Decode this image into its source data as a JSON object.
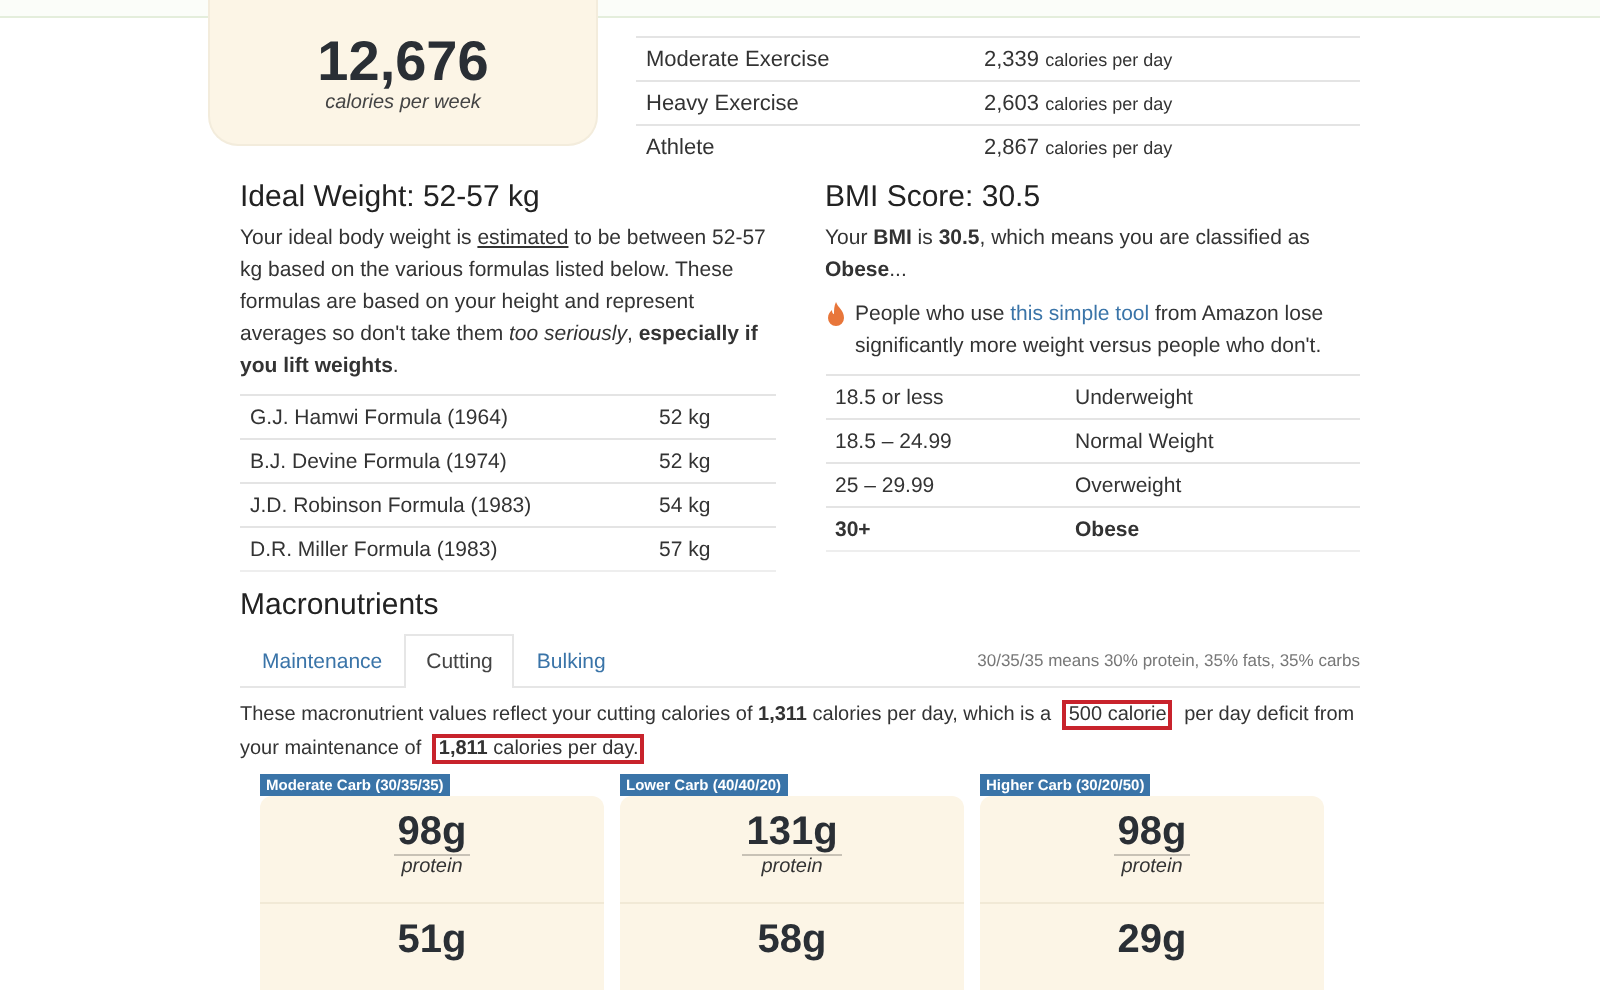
{
  "summary": {
    "value": "12,676",
    "unit": "calories per week"
  },
  "activity_levels": [
    {
      "name": "Moderate Exercise",
      "value": "2,339",
      "unit": "calories per day"
    },
    {
      "name": "Heavy Exercise",
      "value": "2,603",
      "unit": "calories per day"
    },
    {
      "name": "Athlete",
      "value": "2,867",
      "unit": "calories per day"
    }
  ],
  "ideal_weight": {
    "title": "Ideal Weight: 52-57 kg",
    "paragraph": [
      {
        "text": "Your ideal body weight is ",
        "kind": "plain"
      },
      {
        "text": "estimated",
        "kind": "underline"
      },
      {
        "text": " to be between 52-57 kg based on the various formulas listed below. These formulas are based on your height and represent averages so don't take them ",
        "kind": "plain"
      },
      {
        "text": "too seriously",
        "kind": "italic"
      },
      {
        "text": ", ",
        "kind": "plain"
      },
      {
        "text": "especially if you lift weights",
        "kind": "bold"
      },
      {
        "text": ".",
        "kind": "plain"
      }
    ],
    "formulas": [
      {
        "name": "G.J. Hamwi Formula (1964)",
        "value": "52 kg"
      },
      {
        "name": "B.J. Devine Formula (1974)",
        "value": "52 kg"
      },
      {
        "name": "J.D. Robinson Formula (1983)",
        "value": "54 kg"
      },
      {
        "name": "D.R. Miller Formula (1983)",
        "value": "57 kg"
      }
    ]
  },
  "bmi": {
    "title": "BMI Score: 30.5",
    "paragraph": [
      {
        "text": "Your ",
        "kind": "plain"
      },
      {
        "text": "BMI",
        "kind": "bold"
      },
      {
        "text": " is ",
        "kind": "plain"
      },
      {
        "text": "30.5",
        "kind": "bold"
      },
      {
        "text": ", which means you are classified as ",
        "kind": "plain"
      },
      {
        "text": "Obese",
        "kind": "bold"
      },
      {
        "text": "...",
        "kind": "plain"
      }
    ],
    "tip": [
      {
        "text": "People who use ",
        "kind": "plain"
      },
      {
        "text": "this simple tool",
        "kind": "link"
      },
      {
        "text": " from Amazon lose significantly more weight versus people who don't.",
        "kind": "plain"
      }
    ],
    "ranges": [
      {
        "range": "18.5 or less",
        "category": "Underweight",
        "selected": false
      },
      {
        "range": "18.5 – 24.99",
        "category": "Normal Weight",
        "selected": false
      },
      {
        "range": "25 – 29.99",
        "category": "Overweight",
        "selected": false
      },
      {
        "range": "30+",
        "category": "Obese",
        "selected": true
      }
    ]
  },
  "macronutrients": {
    "title": "Macronutrients",
    "tabs": [
      {
        "label": "Maintenance",
        "selected": false
      },
      {
        "label": "Cutting",
        "selected": true
      },
      {
        "label": "Bulking",
        "selected": false
      }
    ],
    "legend": "30/35/35 means 30% protein, 35% fats, 35% carbs",
    "paragraph": [
      {
        "text": "These macronutrient values reflect your cutting calories of ",
        "kind": "plain"
      },
      {
        "text": "1,311",
        "kind": "bold"
      },
      {
        "text": " calories per day, which is a ",
        "kind": "plain"
      },
      {
        "text": "500 calorie",
        "kind": "highlight"
      },
      {
        "text": " per day deficit from your maintenance of ",
        "kind": "plain"
      },
      {
        "text": "**1,811** calories per day.",
        "kind": "highlight"
      }
    ],
    "plans": [
      {
        "label": "Moderate Carb (30/35/35)",
        "protein": "98g",
        "protein_label": "protein",
        "fats": "51g"
      },
      {
        "label": "Lower Carb (40/40/20)",
        "protein": "131g",
        "protein_label": "protein",
        "fats": "58g"
      },
      {
        "label": "Higher Carb (30/20/50)",
        "protein": "98g",
        "protein_label": "protein",
        "fats": "29g"
      }
    ]
  }
}
